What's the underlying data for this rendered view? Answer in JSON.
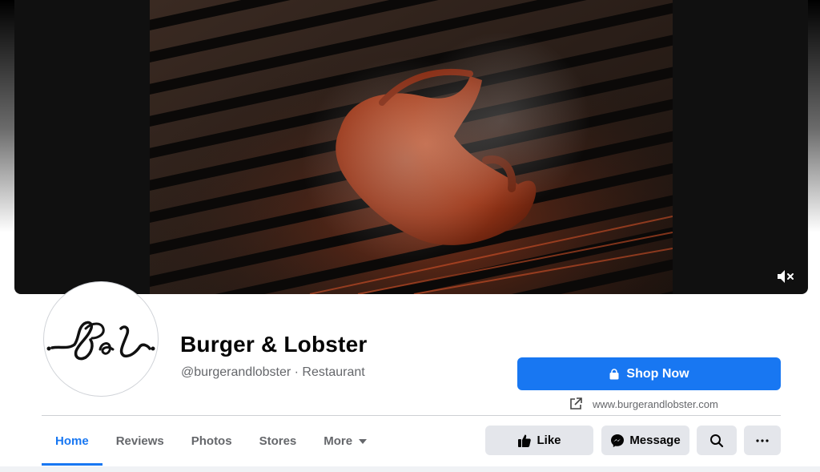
{
  "page": {
    "name": "Burger & Lobster",
    "handle_category": "@burgerandlobster · Restaurant",
    "website": "www.burgerandlobster.com"
  },
  "actions": {
    "shop_now": "Shop Now",
    "like": "Like",
    "message": "Message"
  },
  "tabs": [
    {
      "label": "Home"
    },
    {
      "label": "Reviews"
    },
    {
      "label": "Photos"
    },
    {
      "label": "Stores"
    },
    {
      "label": "More"
    }
  ],
  "icons": [
    "mute-icon",
    "shopping-bag-icon",
    "external-link-icon",
    "thumbs-up-icon",
    "messenger-icon",
    "search-icon",
    "more-icon",
    "caret-down-icon"
  ],
  "colors": {
    "accent": "#1877f2",
    "secondary_button": "#e4e6eb",
    "muted_text": "#65676b"
  }
}
